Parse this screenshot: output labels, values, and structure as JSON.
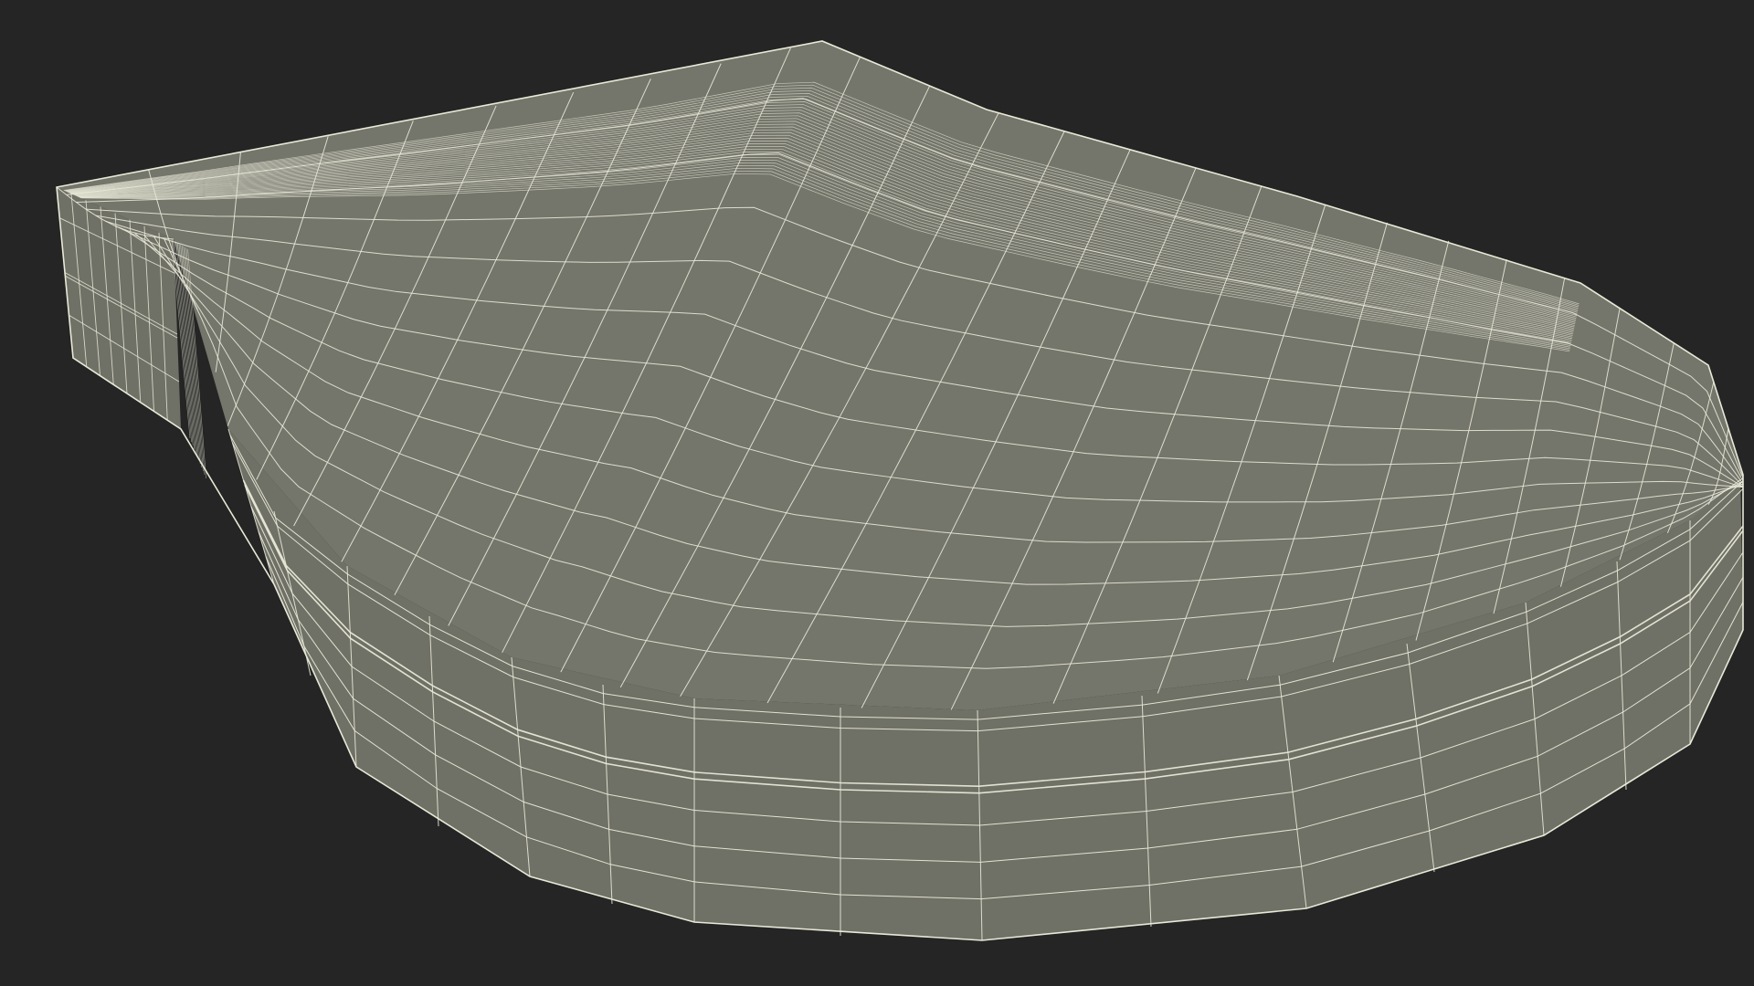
{
  "scene": {
    "background_color": "#252525",
    "surface_color": "#74756b",
    "side_color": "#6f7066",
    "wire_color": "#e9e9d8",
    "view_mode": "wireframe-on-shaded",
    "object": "rounded-seat-cushion"
  }
}
